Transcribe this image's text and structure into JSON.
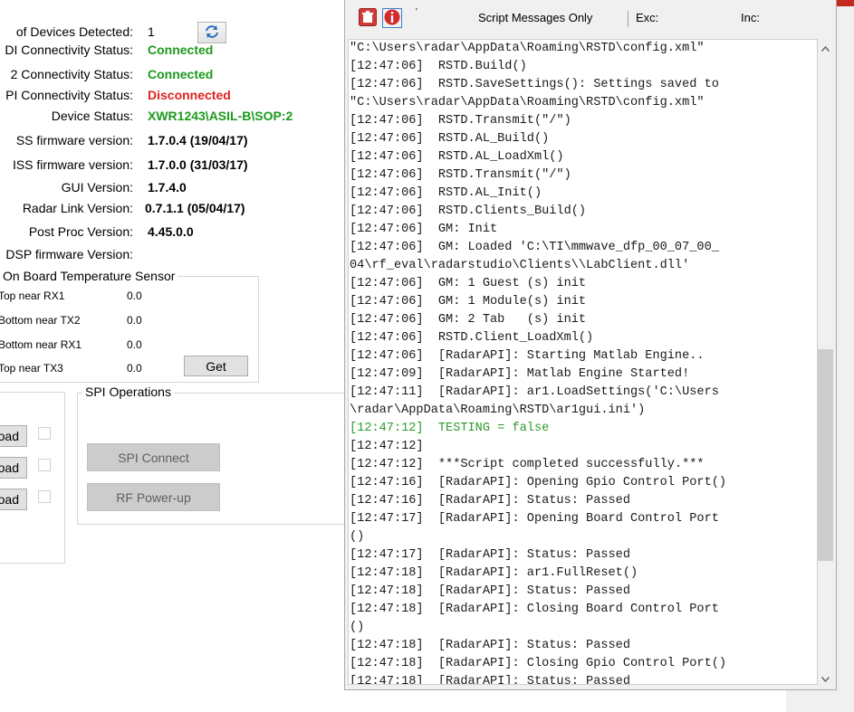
{
  "device_info": {
    "rows": [
      {
        "label": "of Devices Detected:",
        "value": "1",
        "status": ""
      },
      {
        "label": "DI Connectivity Status:",
        "value": "Connected",
        "status": "green"
      },
      {
        "label": "2 Connectivity Status:",
        "value": "Connected",
        "status": "green"
      },
      {
        "label": "PI Connectivity Status:",
        "value": "Disconnected",
        "status": "red"
      },
      {
        "label": "Device Status:",
        "value": "XWR1243\\ASIL-B\\SOP:2",
        "status": "green"
      },
      {
        "label": "SS firmware version:",
        "value": "1.7.0.4 (19/04/17)",
        "status": ""
      },
      {
        "label": "ISS firmware version:",
        "value": "1.7.0.0 (31/03/17)",
        "status": ""
      },
      {
        "label": "GUI Version:",
        "value": "1.7.4.0",
        "status": ""
      },
      {
        "label": "Radar Link Version:",
        "value": "0.7.1.1 (05/04/17)",
        "status": ""
      },
      {
        "label": "Post Proc Version:",
        "value": "4.45.0.0",
        "status": ""
      },
      {
        "label": "DSP firmware Version:",
        "value": "",
        "status": ""
      }
    ]
  },
  "temperature": {
    "title": "On Board Temperature Sensor",
    "rows": [
      {
        "label": "Top near RX1",
        "value": "0.0"
      },
      {
        "label": "Bottom near TX2",
        "value": "0.0"
      },
      {
        "label": "Bottom near RX1",
        "value": "0.0"
      },
      {
        "label": "Top near TX3",
        "value": "0.0"
      }
    ],
    "get_label": "Get"
  },
  "load_group": {
    "buttons": [
      "oad",
      "oad",
      "oad"
    ]
  },
  "spi": {
    "title": "SPI Operations",
    "connect_label": "SPI Connect",
    "powerup_label": "RF Power-up"
  },
  "script_window": {
    "filter_label": "Script Messages Only",
    "exc_label": "Exc:",
    "inc_label": "Inc:",
    "toolbar_dot": "'",
    "lines": [
      {
        "text": "\"C:\\Users\\radar\\AppData\\Roaming\\RSTD\\config.xml\"",
        "color": ""
      },
      {
        "text": "[12:47:06]  RSTD.Build()",
        "color": ""
      },
      {
        "text": "[12:47:06]  RSTD.SaveSettings(): Settings saved to",
        "color": ""
      },
      {
        "text": "\"C:\\Users\\radar\\AppData\\Roaming\\RSTD\\config.xml\"",
        "color": ""
      },
      {
        "text": "[12:47:06]  RSTD.Transmit(\"/\")",
        "color": ""
      },
      {
        "text": "[12:47:06]  RSTD.AL_Build()",
        "color": ""
      },
      {
        "text": "[12:47:06]  RSTD.AL_LoadXml()",
        "color": ""
      },
      {
        "text": "[12:47:06]  RSTD.Transmit(\"/\")",
        "color": ""
      },
      {
        "text": "[12:47:06]  RSTD.AL_Init()",
        "color": ""
      },
      {
        "text": "[12:47:06]  RSTD.Clients_Build()",
        "color": ""
      },
      {
        "text": "[12:47:06]  GM: Init",
        "color": ""
      },
      {
        "text": "[12:47:06]  GM: Loaded 'C:\\TI\\mmwave_dfp_00_07_00_",
        "color": ""
      },
      {
        "text": "04\\rf_eval\\radarstudio\\Clients\\\\LabClient.dll'",
        "color": ""
      },
      {
        "text": "[12:47:06]  GM: 1 Guest (s) init",
        "color": ""
      },
      {
        "text": "[12:47:06]  GM: 1 Module(s) init",
        "color": ""
      },
      {
        "text": "[12:47:06]  GM: 2 Tab   (s) init",
        "color": ""
      },
      {
        "text": "[12:47:06]  RSTD.Client_LoadXml()",
        "color": ""
      },
      {
        "text": "[12:47:06]  [RadarAPI]: Starting Matlab Engine..",
        "color": ""
      },
      {
        "text": "[12:47:09]  [RadarAPI]: Matlab Engine Started!",
        "color": ""
      },
      {
        "text": "[12:47:11]  [RadarAPI]: ar1.LoadSettings('C:\\Users",
        "color": ""
      },
      {
        "text": "\\radar\\AppData\\Roaming\\RSTD\\ar1gui.ini')",
        "color": ""
      },
      {
        "text": "[12:47:12]  TESTING = false",
        "color": "green"
      },
      {
        "text": "[12:47:12]",
        "color": ""
      },
      {
        "text": "[12:47:12]  ***Script completed successfully.***",
        "color": ""
      },
      {
        "text": "[12:47:16]  [RadarAPI]: Opening Gpio Control Port()",
        "color": ""
      },
      {
        "text": "[12:47:16]  [RadarAPI]: Status: Passed",
        "color": ""
      },
      {
        "text": "[12:47:17]  [RadarAPI]: Opening Board Control Port",
        "color": ""
      },
      {
        "text": "()",
        "color": ""
      },
      {
        "text": "[12:47:17]  [RadarAPI]: Status: Passed",
        "color": ""
      },
      {
        "text": "[12:47:18]  [RadarAPI]: ar1.FullReset()",
        "color": ""
      },
      {
        "text": "[12:47:18]  [RadarAPI]: Status: Passed",
        "color": ""
      },
      {
        "text": "[12:47:18]  [RadarAPI]: Closing Board Control Port",
        "color": ""
      },
      {
        "text": "()",
        "color": ""
      },
      {
        "text": "[12:47:18]  [RadarAPI]: Status: Passed",
        "color": ""
      },
      {
        "text": "[12:47:18]  [RadarAPI]: Closing Gpio Control Port()",
        "color": ""
      },
      {
        "text": "[12:47:18]  [RadarAPI]: Status: Passed",
        "color": ""
      }
    ],
    "scroll_position": 0.73
  },
  "colors": {
    "connected": "#1d9a1d",
    "disconnected": "#e02020",
    "log_highlight": "#2d9a2d",
    "close_button": "#c42b1c"
  },
  "icons": [
    "refresh-icon",
    "clear-icon",
    "info-icon",
    "scroll-up-icon",
    "scroll-down-icon"
  ]
}
